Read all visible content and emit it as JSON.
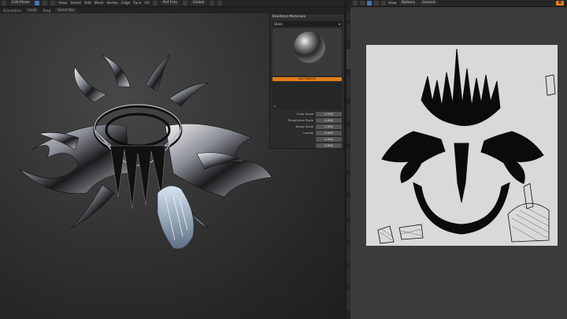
{
  "viewport": {
    "mode": "Edit Mode",
    "menus": [
      "View",
      "Select",
      "Add",
      "Mesh",
      "Vertex",
      "Edge",
      "Face",
      "UV"
    ],
    "transform_orientation_label": "Orientation:",
    "transform_orientation": "Local",
    "drag_label": "Drag:",
    "drag_value": "Select Box",
    "pivot": "Ref Fxts",
    "coord_space": "Global"
  },
  "material_panel": {
    "title": "Realtime Materials",
    "slot_name": "Glass",
    "add_button": "Add Material",
    "params": [
      {
        "label": "Color Scale",
        "value": "0.200"
      },
      {
        "label": "Roughness Scale",
        "value": "0.500"
      },
      {
        "label": "Bump Scale",
        "value": "1.000"
      },
      {
        "label": "Coords",
        "value": "0.000"
      },
      {
        "label": "",
        "value": "0.000"
      },
      {
        "label": "",
        "value": "0.000"
      }
    ]
  },
  "uv_editor": {
    "options_label": "Options",
    "uv_map": "Ground",
    "view_label": "View"
  },
  "colors": {
    "accent": "#e37c1b",
    "selected": "#4772b3"
  }
}
